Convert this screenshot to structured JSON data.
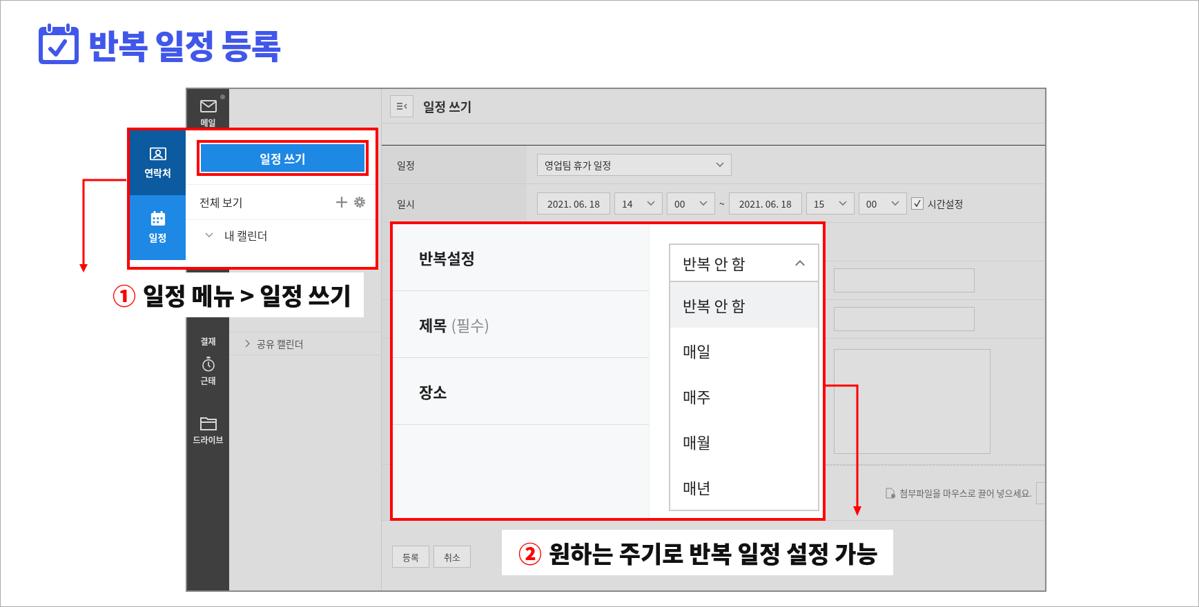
{
  "title": "반복 일정 등록",
  "nav": [
    {
      "label": "메일",
      "badge": true
    },
    {
      "label": "결재",
      "badge": false
    },
    {
      "label": "근태",
      "badge": false
    },
    {
      "label": "드라이브",
      "badge": false
    }
  ],
  "side_panel": {
    "tree": [
      {
        "label": "공유 캘린더",
        "expanded": false
      }
    ]
  },
  "main": {
    "header": "일정 쓰기",
    "calendar_row": {
      "label": "일정",
      "value": "영업팀 휴가 일정"
    },
    "datetime_row": {
      "label": "일시",
      "start_date": "2021. 06. 18",
      "start_hour": "14",
      "start_minute": "00",
      "separator": "~",
      "end_date": "2021. 06. 18",
      "end_hour": "15",
      "end_minute": "00",
      "time_setting": {
        "label": "시간설정",
        "checked": true
      }
    },
    "attach_hint": "첨부파일을 마우스로 끌어 넣으세요.",
    "buttons": [
      "등록",
      "취소"
    ]
  },
  "callout_1": {
    "nav": [
      {
        "label": "연락처",
        "selected": false
      },
      {
        "label": "일정",
        "selected": true
      }
    ],
    "write_button": "일정 쓰기",
    "view_all": "전체 보기",
    "tree": [
      {
        "label": "내 캘린더",
        "expanded": true
      }
    ],
    "marker": "①",
    "caption": "일정 메뉴 > 일정 쓰기"
  },
  "callout_2": {
    "rows": [
      {
        "label": "반복설정"
      },
      {
        "label": "제목",
        "note": "(필수)"
      },
      {
        "label": "장소"
      }
    ],
    "dropdown": {
      "value": "반복 안 함",
      "expanded": true,
      "options": [
        {
          "label": "반복 안 함",
          "selected": true
        },
        {
          "label": "매일",
          "selected": false
        },
        {
          "label": "매주",
          "selected": false
        },
        {
          "label": "매월",
          "selected": false
        },
        {
          "label": "매년",
          "selected": false
        }
      ]
    },
    "marker": "②",
    "caption": "원하는 주기로 반복 일정 설정 가능"
  }
}
